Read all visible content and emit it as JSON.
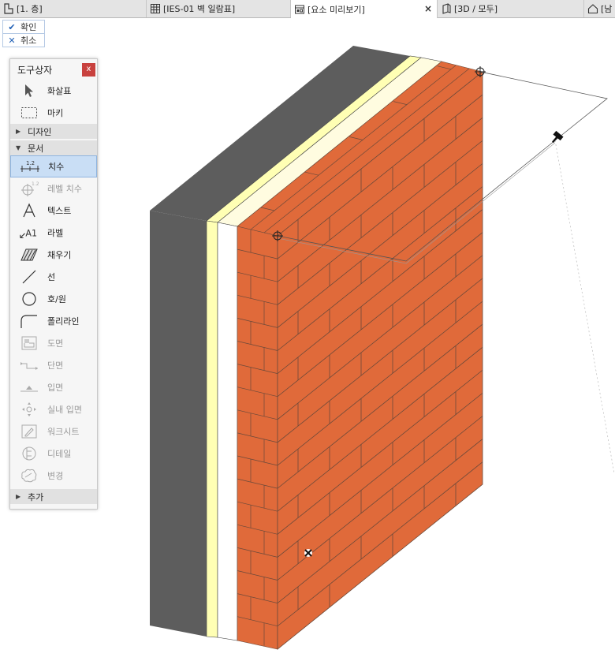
{
  "tabs": [
    {
      "label": "[1. 층]",
      "icon": "floor-plan-icon",
      "active": false
    },
    {
      "label": "[IES-01 벽 일람표]",
      "icon": "schedule-grid-icon",
      "active": false
    },
    {
      "label": "[요소 미리보기]",
      "icon": "element-preview-icon",
      "active": true,
      "close": "×"
    },
    {
      "label": "[3D / 모두]",
      "icon": "3d-view-icon",
      "active": false
    },
    {
      "label": "[남",
      "icon": "elevation-icon",
      "active": false
    }
  ],
  "commands": {
    "confirm": "확인",
    "cancel": "취소"
  },
  "palette": {
    "title": "도구상자",
    "close": "x",
    "arrow_label": "화살표",
    "marquee_label": "마키",
    "groups": {
      "design": "디자인",
      "document": "문서",
      "more": "추가"
    },
    "tools": {
      "dimension": "치수",
      "level_dimension": "레벨 치수",
      "text": "텍스트",
      "label": "라벨",
      "fill": "채우기",
      "line": "선",
      "arc_circle": "호/원",
      "polyline": "폴리라인",
      "drawing": "도면",
      "section": "단면",
      "elevation": "입면",
      "interior_elevation": "실내 입면",
      "worksheet": "워크시트",
      "detail": "디테일",
      "change": "변경"
    },
    "icon_text": {
      "dimension_value": "1.2",
      "label_glyph": "A1"
    }
  },
  "colors": {
    "brick": "#e06a3a",
    "mortar": "#6b4a3a",
    "insulation": "#ffffb4",
    "core": "#5d5d5d",
    "selection": "#c9def5",
    "accent": "#1f5fb5",
    "close_button": "#c8413e"
  }
}
